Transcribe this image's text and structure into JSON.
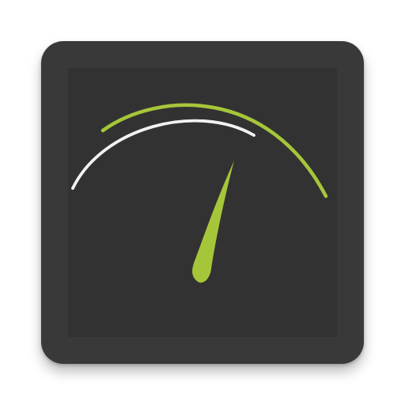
{
  "app_icon": {
    "icon_name": "speedometer-gauge-icon",
    "colors": {
      "tile": "#3a3939",
      "inner_panel": "#333232",
      "accent_green": "#a6c63a",
      "white_arc": "#f2f2f2",
      "needle": "#a6c63a"
    }
  }
}
